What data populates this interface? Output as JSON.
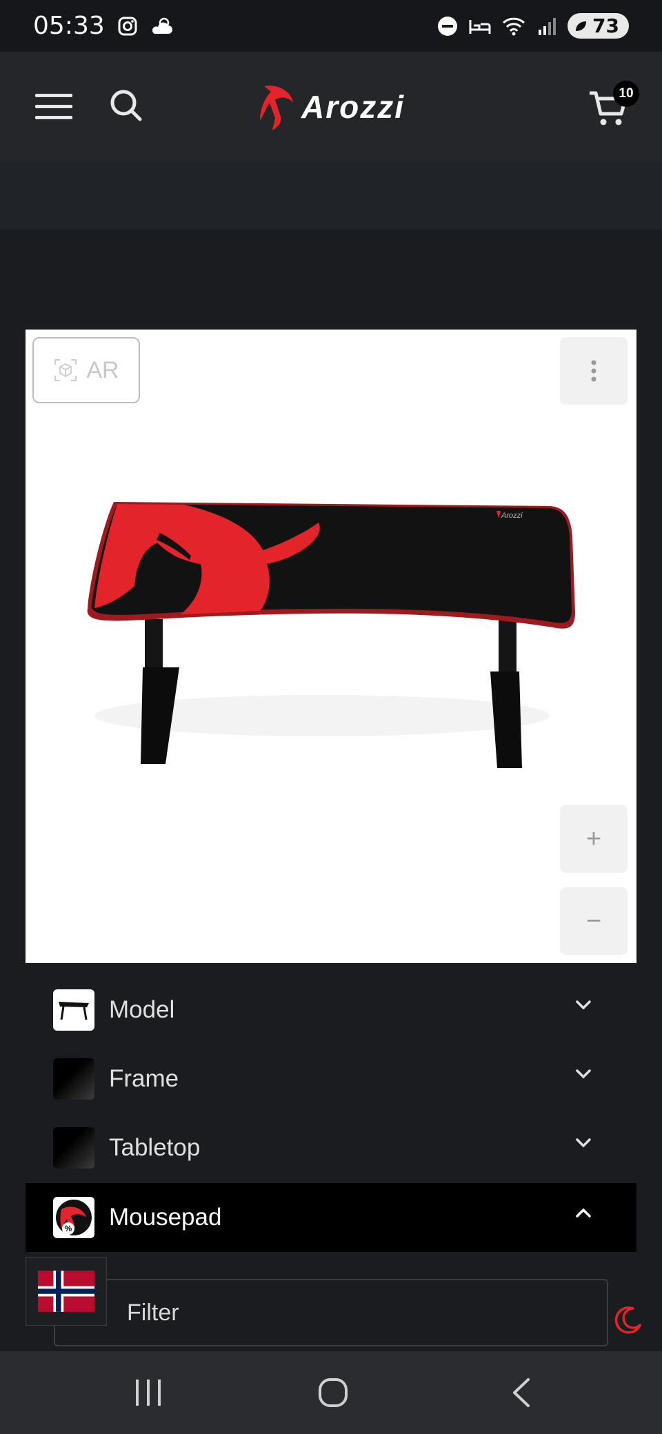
{
  "status_bar": {
    "time": "05:33",
    "battery": "73"
  },
  "header": {
    "logo_text": "Arozzi",
    "cart_count": "10"
  },
  "viewer": {
    "ar_label": "AR",
    "product_logo_text": "Arozzi",
    "zoom_in_label": "+",
    "zoom_out_label": "−"
  },
  "configurator": {
    "sections": [
      {
        "label": "Model",
        "expanded": false
      },
      {
        "label": "Frame",
        "expanded": false
      },
      {
        "label": "Tabletop",
        "expanded": false
      },
      {
        "label": "Mousepad",
        "expanded": true
      }
    ],
    "filter_placeholder": "Filter"
  },
  "colors": {
    "brand_red": "#e4242b",
    "active_row": "#000000",
    "page_bg": "#1b1c1f"
  },
  "icons": [
    "menu-icon",
    "search-icon",
    "cart-icon",
    "ar-cube-icon",
    "more-vertical-icon",
    "plus-icon",
    "minus-icon",
    "chevron-down-icon",
    "chevron-up-icon",
    "norway-flag-icon",
    "moon-icon",
    "recents-icon",
    "home-icon",
    "back-icon"
  ]
}
